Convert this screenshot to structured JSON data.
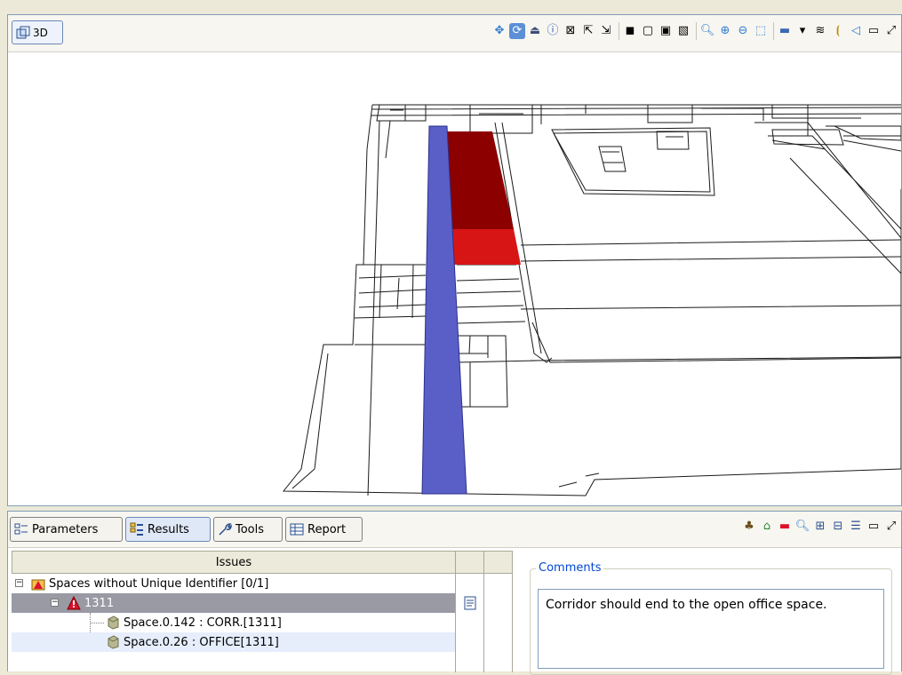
{
  "view3d": {
    "tab_label": "3D",
    "toolbar_icons": [
      "pan-icon",
      "rotate-icon",
      "eject-icon",
      "info-icon",
      "measure-icon",
      "select-icon",
      "select-multi-icon",
      "box-solid-icon",
      "box-wire-icon",
      "box-shaded-icon",
      "box-section-icon",
      "zoom-icon",
      "zoom-in-icon",
      "zoom-out-icon",
      "zoom-fit-icon",
      "window-icon",
      "dropdown-icon",
      "layers-icon",
      "split-icon",
      "transparency-icon",
      "minimize-icon",
      "maximize-icon"
    ]
  },
  "tabs": [
    {
      "label": "Parameters"
    },
    {
      "label": "Results"
    },
    {
      "label": "Tools"
    },
    {
      "label": "Report"
    }
  ],
  "issues": {
    "header": "Issues",
    "rows": [
      {
        "label": "Spaces without Unique Identifier [0/1]"
      },
      {
        "label": "1311"
      },
      {
        "label": "Space.0.142 : CORR.[1311]"
      },
      {
        "label": "Space.0.26 : OFFICE[1311]"
      }
    ]
  },
  "comments": {
    "legend": "Comments",
    "text": "Corridor should end to the open office space."
  },
  "colors": {
    "highlight_blue": "#5a5fc8",
    "highlight_red": "#cc1010",
    "selected_row": "#9a9aa5",
    "comments_legend": "#0046d5"
  }
}
